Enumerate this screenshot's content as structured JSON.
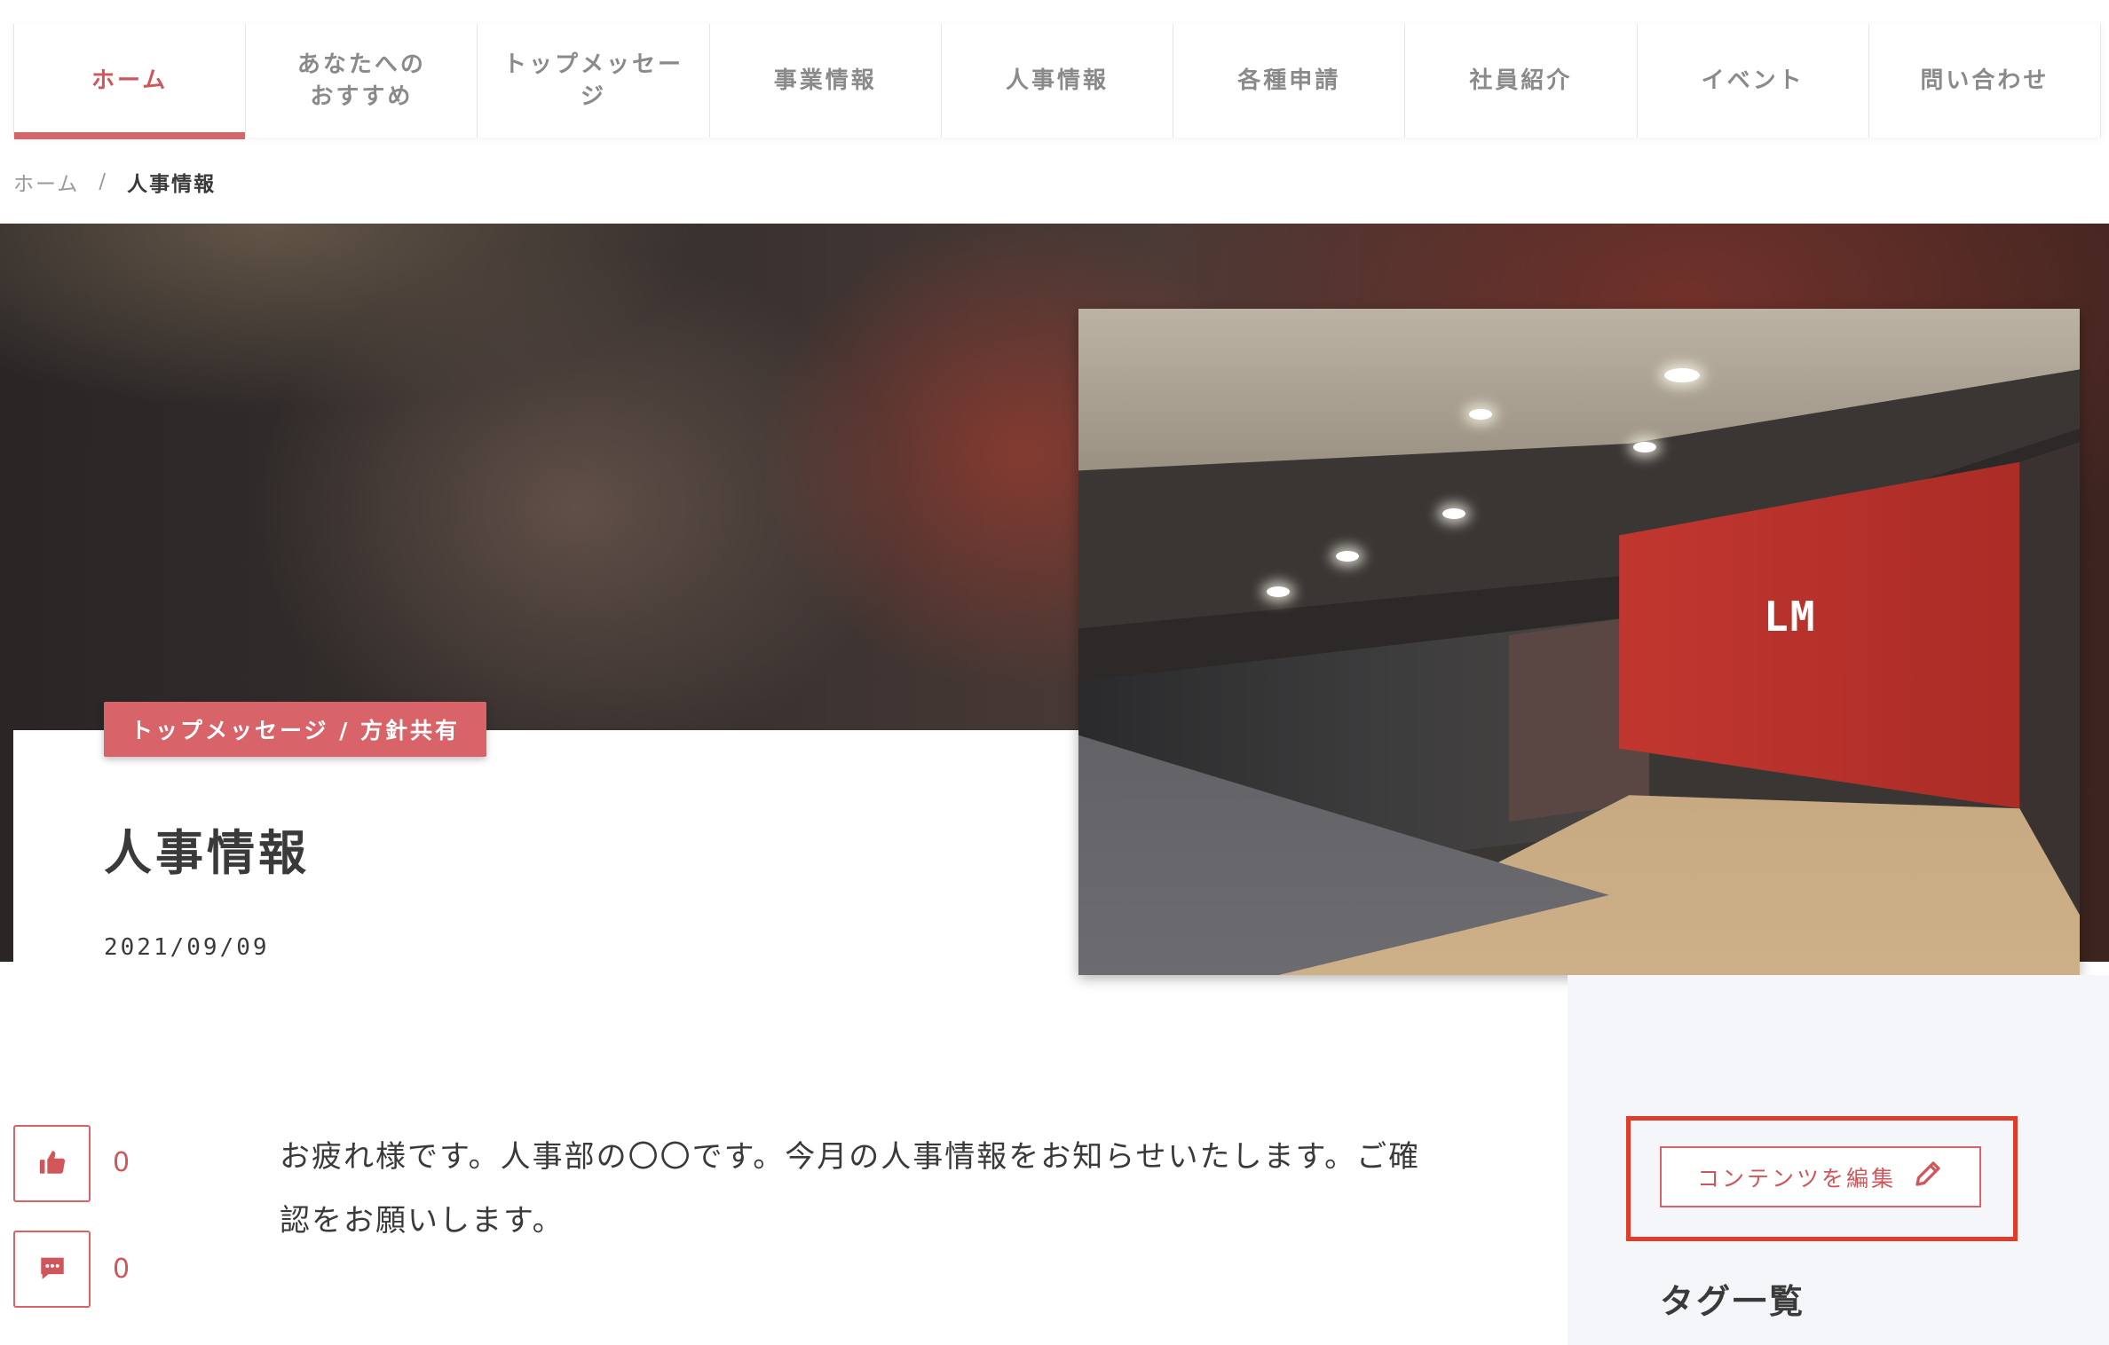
{
  "nav": {
    "items": [
      {
        "label": "ホーム",
        "active": true
      },
      {
        "label": "あなたへの\nおすすめ",
        "active": false
      },
      {
        "label": "トップメッセー\nジ",
        "active": false
      },
      {
        "label": "事業情報",
        "active": false
      },
      {
        "label": "人事情報",
        "active": false
      },
      {
        "label": "各種申請",
        "active": false
      },
      {
        "label": "社員紹介",
        "active": false
      },
      {
        "label": "イベント",
        "active": false
      },
      {
        "label": "問い合わせ",
        "active": false
      }
    ]
  },
  "breadcrumb": {
    "home": "ホーム",
    "separator": "/",
    "current": "人事情報"
  },
  "article": {
    "category_tag": "トップメッセージ / 方針共有",
    "title": "人事情報",
    "date": "2021/09/09",
    "body": "お疲れ様です。人事部の〇〇です。今月の人事情報をお知らせいたします。ご確認をお願いします。",
    "photo_logo": "LM"
  },
  "reactions": {
    "like_count": "0",
    "comment_count": "0"
  },
  "sidebar": {
    "edit_button_label": "コンテンツを編集",
    "tag_list_heading": "タグ一覧"
  },
  "icons": {
    "like": "thumbs-up-icon",
    "comment": "comment-icon",
    "edit": "pencil-icon"
  },
  "colors": {
    "accent": "#d8646a",
    "highlight_box": "#e03c2a",
    "sidebar_bg": "#f5f6f9"
  }
}
